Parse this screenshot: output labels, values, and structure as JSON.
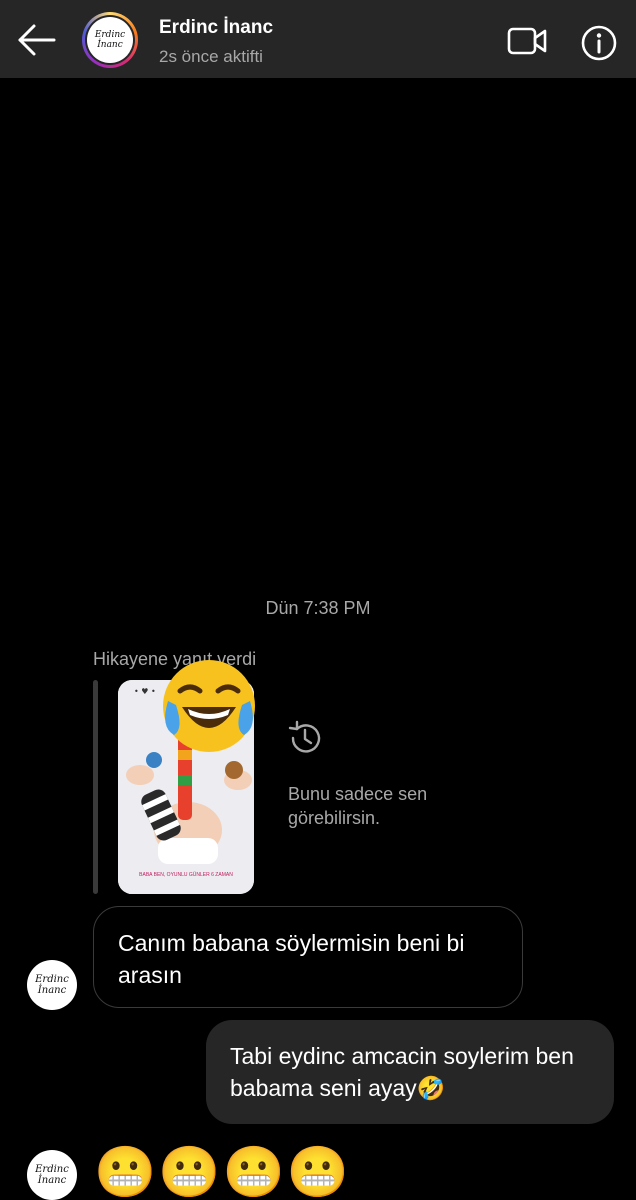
{
  "header": {
    "name": "Erdinc İnanc",
    "status": "2s önce aktifti",
    "avatar_text": "Erdinc İnanc"
  },
  "chat": {
    "timestamp": "Dün 7:38 PM",
    "story_reply_label": "Hikayene yanıt verdi",
    "story_note": "Bunu sadece sen görebilirsin.",
    "story_caption": "BABA BEN, OYUNLU GÜNLER 6 ZAMAN",
    "messages": [
      {
        "from": "them",
        "text": "Canım babana söylermisin beni bi arasın"
      },
      {
        "from": "me",
        "text": "Tabi eydinc amcacin soylerim ben babama seni ayay🤣"
      },
      {
        "from": "them",
        "text": "😬😬😬😬"
      }
    ]
  },
  "icons": {
    "back": "arrow-left-icon",
    "video": "video-camera-icon",
    "info": "info-icon",
    "history": "history-icon",
    "cover_emoji": "😂"
  }
}
